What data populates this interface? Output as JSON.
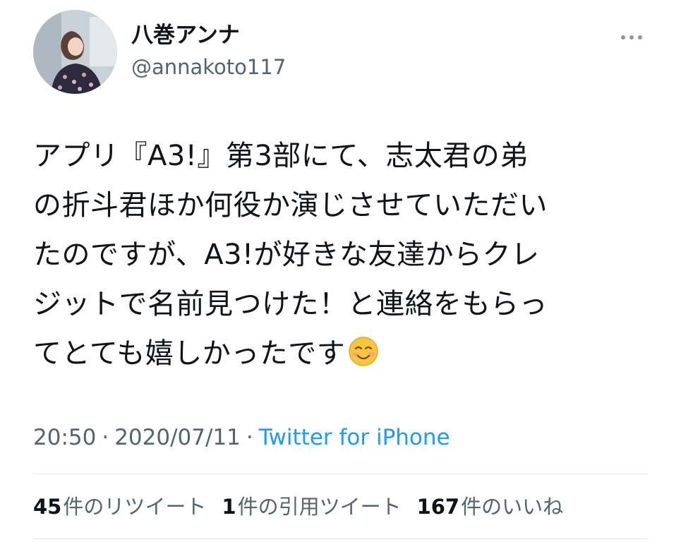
{
  "user": {
    "display_name": "八巻アンナ",
    "handle": "@annakoto117"
  },
  "tweet": {
    "lines": [
      "アプリ『A3!』第3部にて、志太君の弟",
      "の折斗君ほか何役か演じさせていただい",
      "たのですが、A3!が好きな友達からクレ",
      "ジットで名前見つけた！と連絡をもらっ",
      "てとても嬉しかったです"
    ],
    "emoji": "smiling-face-icon"
  },
  "meta": {
    "time": "20:50",
    "separator1": "·",
    "date": "2020/07/11",
    "separator2": "·",
    "source": "Twitter for iPhone",
    "source_color": "#1d9bf0"
  },
  "stats": {
    "retweets": {
      "count": "45",
      "label": "件のリツイート"
    },
    "quotes": {
      "count": "1",
      "label": "件の引用ツイート"
    },
    "likes": {
      "count": "167",
      "label": "件のいいね"
    }
  },
  "icons": {
    "more": "more-horizontal-icon"
  }
}
